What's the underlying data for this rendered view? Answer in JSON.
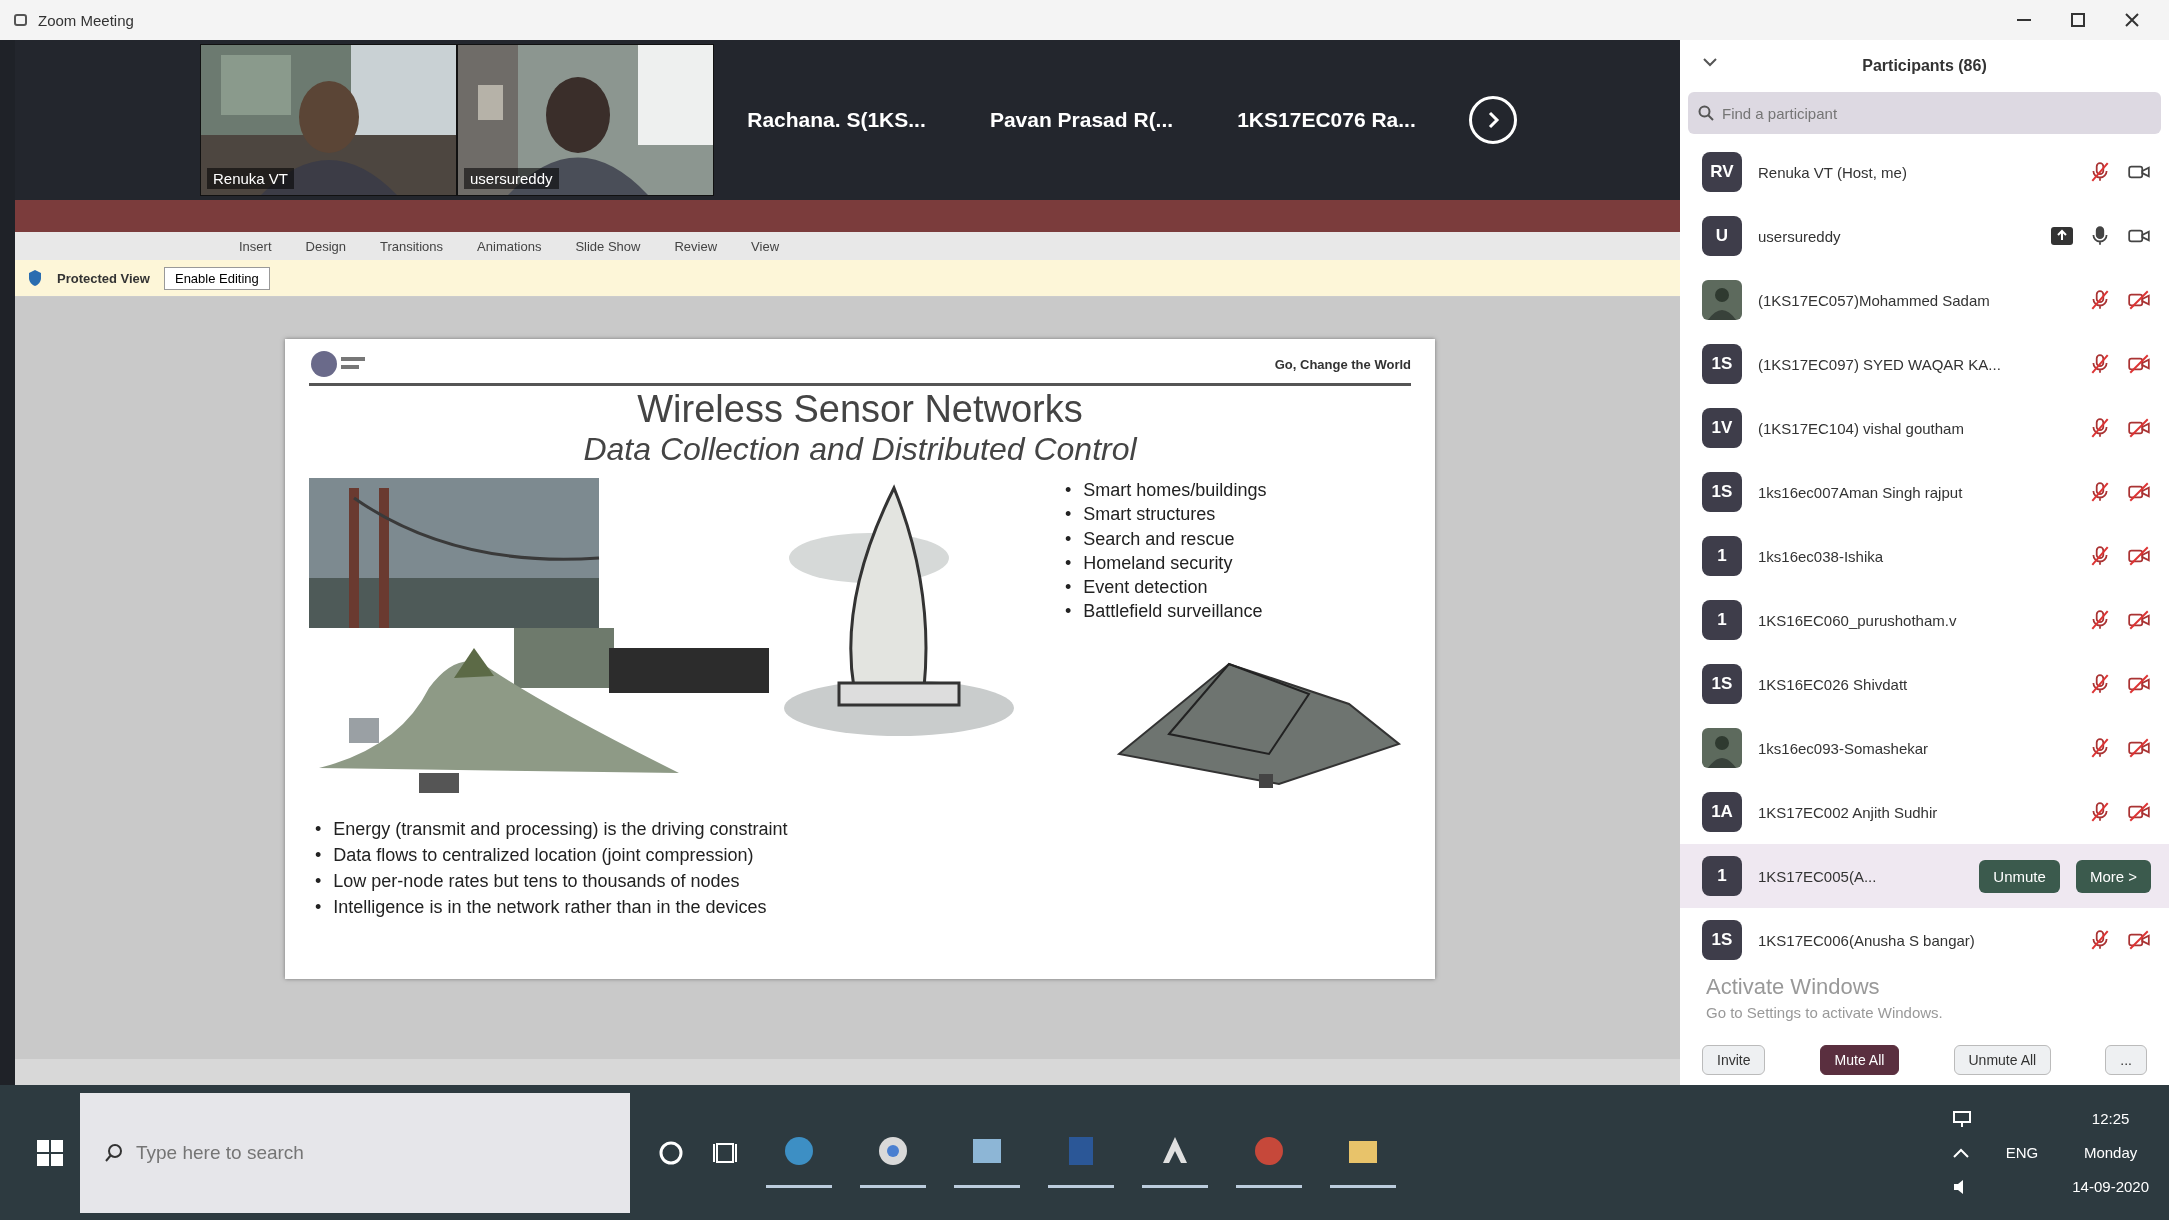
{
  "window": {
    "title": "Zoom Meeting"
  },
  "video_strip": {
    "tiles": [
      {
        "kind": "video",
        "name": "Renuka VT"
      },
      {
        "kind": "video",
        "name": "usersureddy"
      },
      {
        "kind": "name",
        "name": "Rachana. S(1KS..."
      },
      {
        "kind": "name",
        "name": "Pavan Prasad R(..."
      },
      {
        "kind": "name",
        "name": "1KS17EC076 Ra..."
      }
    ]
  },
  "presentation": {
    "ribbon_tabs": [
      "Insert",
      "Design",
      "Transitions",
      "Animations",
      "Slide Show",
      "Review",
      "View"
    ],
    "protected_view": {
      "label": "Protected View",
      "button": "Enable Editing"
    },
    "slide": {
      "tagline": "Go, Change the World",
      "title": "Wireless Sensor Networks",
      "subtitle": "Data Collection and Distributed Control",
      "applications": [
        {
          "marker": "•",
          "text": "Smart homes/buildings"
        },
        {
          "marker": "•",
          "text": "Smart structures"
        },
        {
          "marker": "•",
          "text": "Search and rescue"
        },
        {
          "marker": "•",
          "text": "Homeland security"
        },
        {
          "marker": "•",
          "text": "Event detection"
        },
        {
          "marker": "•",
          "text": "Battlefield surveillance"
        }
      ],
      "points": [
        {
          "marker": "•",
          "text": "Energy (transmit and processing) is the driving constraint"
        },
        {
          "marker": "•",
          "text": "Data flows to centralized location (joint compression)"
        },
        {
          "marker": "•",
          "text": "Low per-node rates but tens to thousands of nodes"
        },
        {
          "marker": "•",
          "text": "Intelligence is in the network rather than in the devices"
        }
      ]
    }
  },
  "participants": {
    "title": "Participants (86)",
    "search": {
      "placeholder": "Find a participant"
    },
    "rows": [
      {
        "avatar": {
          "kind": "initials",
          "text": "RV"
        },
        "name": "Renuka VT (Host, me)",
        "sharing": false,
        "mic_muted": true,
        "video_off": false,
        "hovered": false
      },
      {
        "avatar": {
          "kind": "initials",
          "text": "U"
        },
        "name": "usersureddy",
        "sharing": true,
        "mic_muted": false,
        "video_off": false,
        "hovered": false
      },
      {
        "name": "(1KS17EC057)Mohammed Sadam",
        "sharing": false,
        "mic_muted": true,
        "video_off": true,
        "hovered": false
      },
      {
        "avatar": {
          "kind": "initials",
          "text": "1S"
        },
        "name": "(1KS17EC097) SYED WAQAR KA...",
        "sharing": false,
        "mic_muted": true,
        "video_off": true,
        "hovered": false
      },
      {
        "avatar": {
          "kind": "initials",
          "text": "1V"
        },
        "name": "(1KS17EC104) vishal goutham",
        "sharing": false,
        "mic_muted": true,
        "video_off": true,
        "hovered": false
      },
      {
        "avatar": {
          "kind": "initials",
          "text": "1S"
        },
        "name": "1ks16ec007Aman Singh rajput",
        "sharing": false,
        "mic_muted": true,
        "video_off": true,
        "hovered": false
      },
      {
        "avatar": {
          "kind": "initials",
          "text": "1"
        },
        "name": "1ks16ec038-Ishika",
        "sharing": false,
        "mic_muted": true,
        "video_off": true,
        "hovered": false
      },
      {
        "avatar": {
          "kind": "initials",
          "text": "1"
        },
        "name": "1KS16EC060_purushotham.v",
        "sharing": false,
        "mic_muted": true,
        "video_off": true,
        "hovered": false
      },
      {
        "avatar": {
          "kind": "initials",
          "text": "1S"
        },
        "name": "1KS16EC026 Shivdatt",
        "sharing": false,
        "mic_muted": true,
        "video_off": true,
        "hovered": false
      },
      {
        "name": "1ks16ec093-Somashekar",
        "sharing": false,
        "mic_muted": true,
        "video_off": true,
        "hovered": false
      },
      {
        "avatar": {
          "kind": "initials",
          "text": "1A"
        },
        "name": "1KS17EC002 Anjith Sudhir",
        "sharing": false,
        "mic_muted": true,
        "video_off": true,
        "hovered": false
      },
      {
        "avatar": {
          "kind": "initials",
          "text": "1"
        },
        "name": "1KS17EC005(A...",
        "hovered": true,
        "buttons": [
          "Unmute",
          "More >"
        ]
      },
      {
        "avatar": {
          "kind": "initials",
          "text": "1S"
        },
        "name": "1KS17EC006(Anusha S bangar)",
        "sharing": false,
        "mic_muted": true,
        "video_off": true,
        "hovered": false
      }
    ],
    "activation": {
      "title": "Activate Windows",
      "hint": "Go to Settings to activate Windows."
    },
    "footer": {
      "invite": "Invite",
      "mute_all": "Mute All",
      "unmute_all": "Unmute All",
      "more": "..."
    }
  },
  "taskbar": {
    "search": {
      "placeholder": "Type here to search"
    },
    "language": "ENG",
    "time": "12:25",
    "day": "Monday",
    "date": "14-09-2020"
  }
}
